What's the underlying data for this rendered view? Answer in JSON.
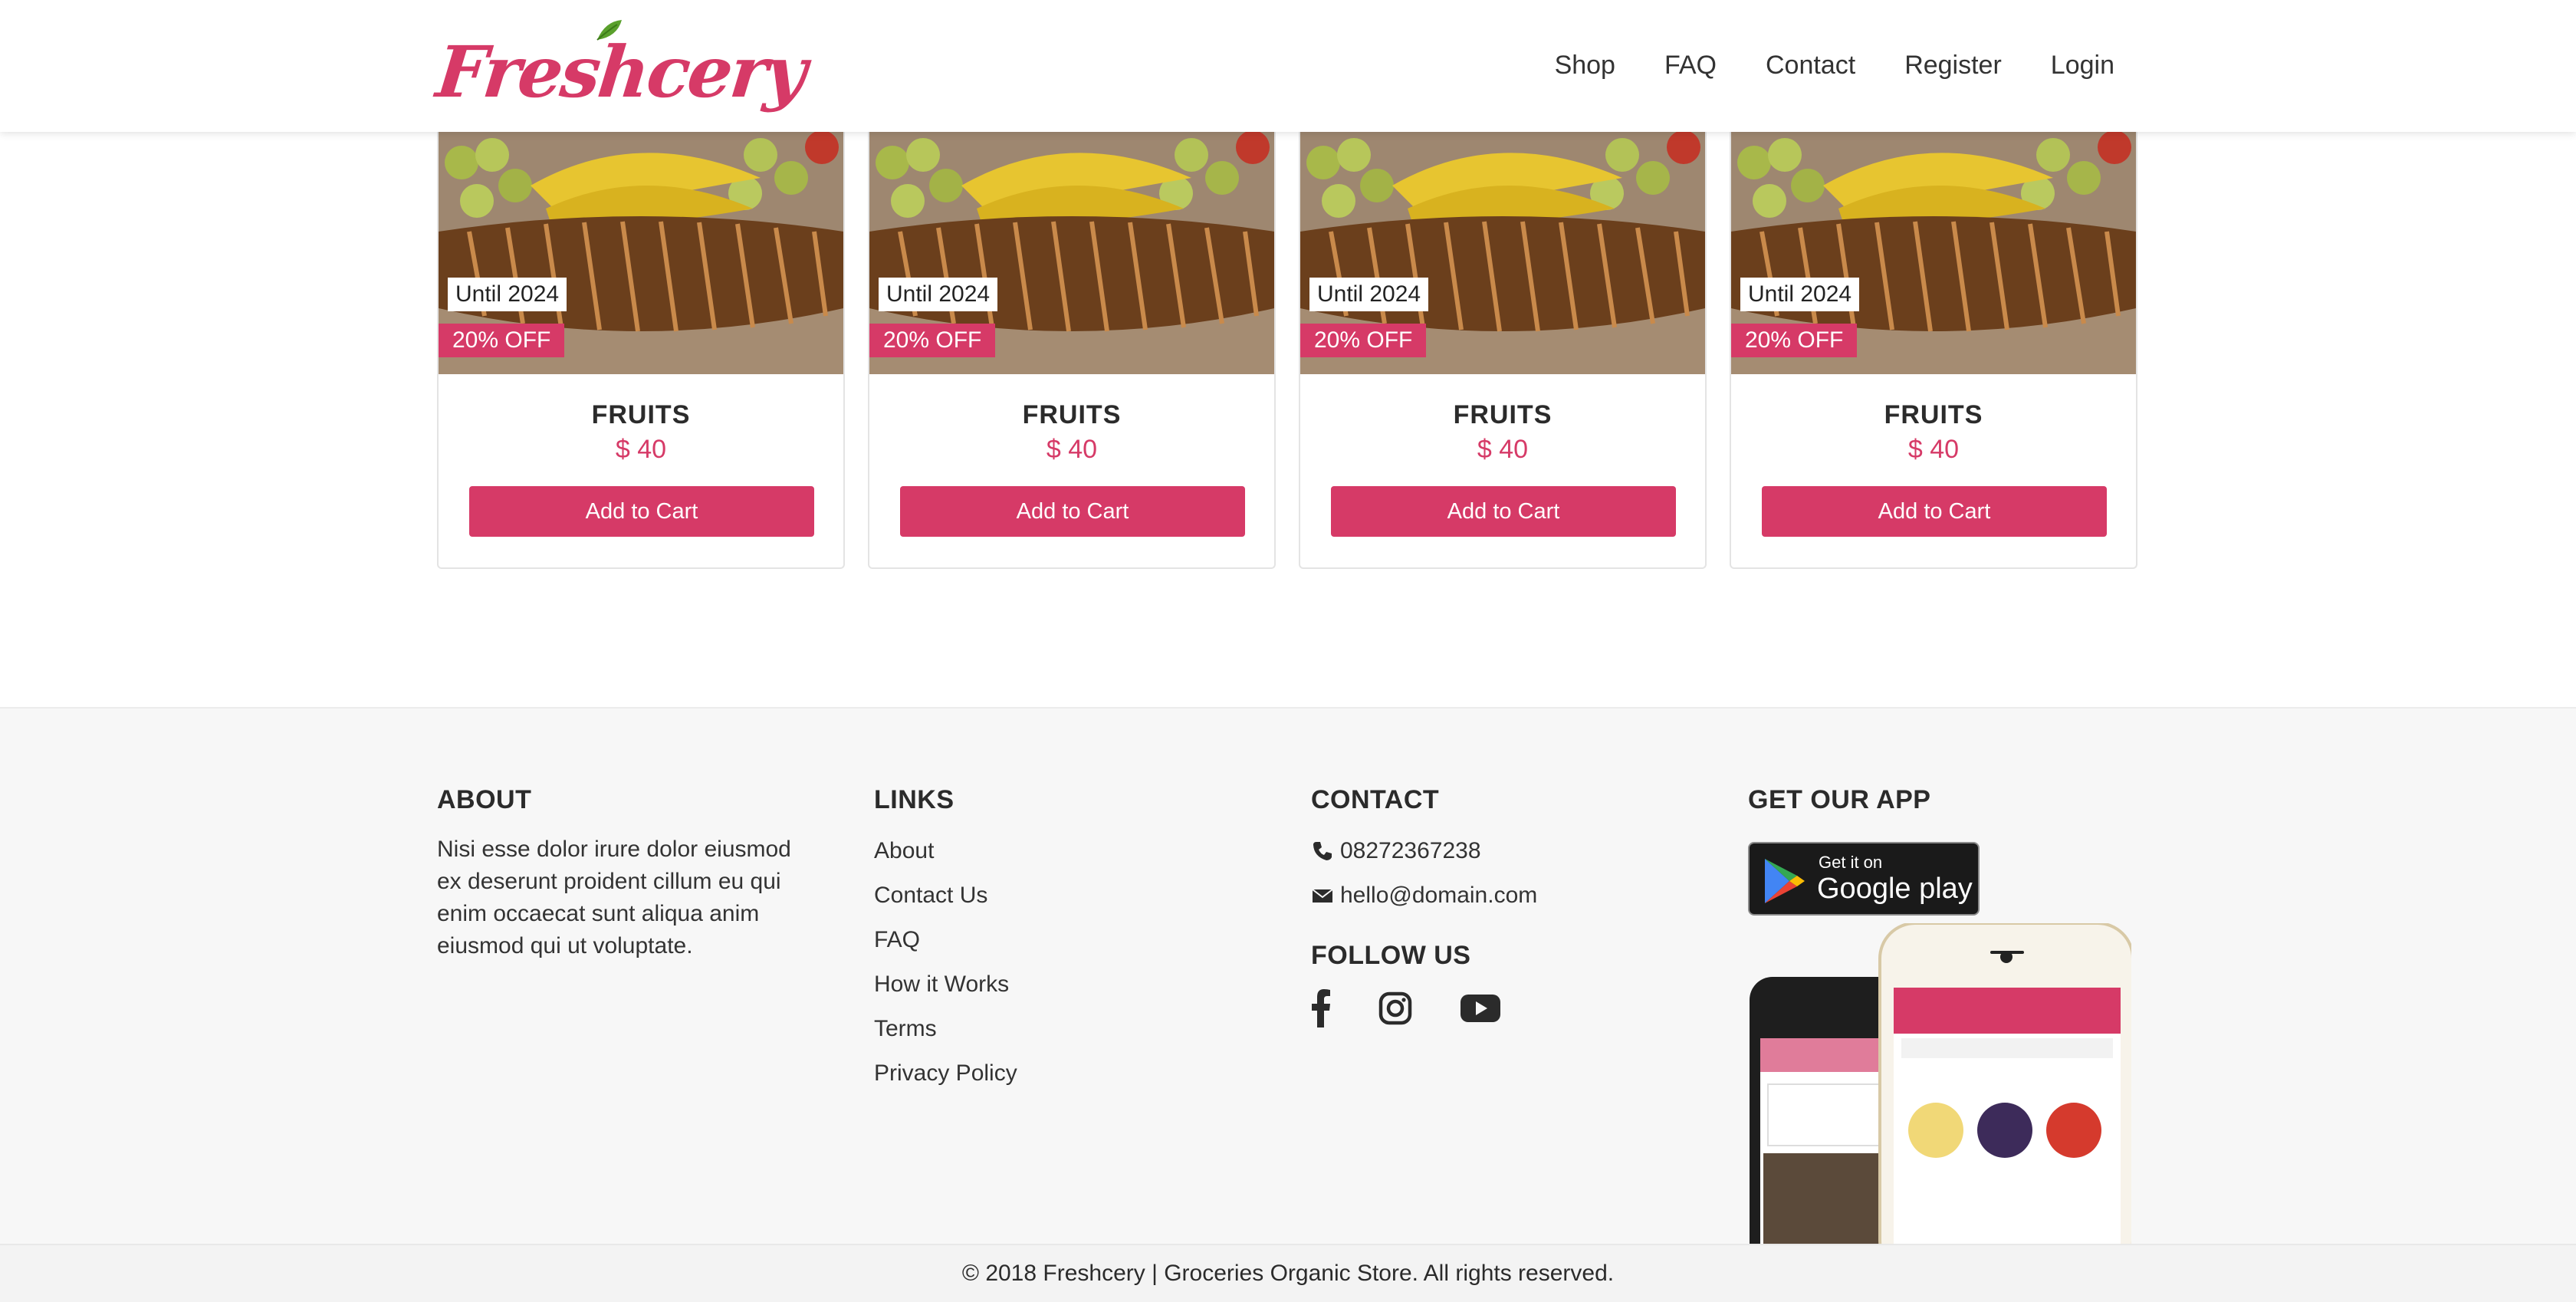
{
  "brand": {
    "name": "Freshcery",
    "color": "#d63a67"
  },
  "nav": {
    "items": [
      {
        "label": "Shop"
      },
      {
        "label": "FAQ"
      },
      {
        "label": "Contact"
      },
      {
        "label": "Register"
      },
      {
        "label": "Login"
      }
    ]
  },
  "products": [
    {
      "until": "Until 2024",
      "discount": "20% OFF",
      "name": "FRUITS",
      "price": "$ 40",
      "button": "Add to Cart"
    },
    {
      "until": "Until 2024",
      "discount": "20% OFF",
      "name": "FRUITS",
      "price": "$ 40",
      "button": "Add to Cart"
    },
    {
      "until": "Until 2024",
      "discount": "20% OFF",
      "name": "FRUITS",
      "price": "$ 40",
      "button": "Add to Cart"
    },
    {
      "until": "Until 2024",
      "discount": "20% OFF",
      "name": "FRUITS",
      "price": "$ 40",
      "button": "Add to Cart"
    }
  ],
  "footer": {
    "about": {
      "title": "ABOUT",
      "text": "Nisi esse dolor irure dolor eiusmod ex deserunt proident cillum eu qui enim occaecat sunt aliqua anim eiusmod qui ut voluptate."
    },
    "links": {
      "title": "LINKS",
      "items": [
        "About",
        "Contact Us",
        "FAQ",
        "How it Works",
        "Terms",
        "Privacy Policy"
      ]
    },
    "contact": {
      "title": "CONTACT",
      "phone": "08272367238",
      "email": "hello@domain.com",
      "follow_title": "FOLLOW US",
      "social_icons": [
        "facebook-icon",
        "instagram-icon",
        "youtube-icon"
      ]
    },
    "app": {
      "title": "GET OUR APP",
      "store_small": "Get it on",
      "store_big": "Google play"
    }
  },
  "copyright": "© 2018 Freshcery | Groceries Organic Store. All rights reserved."
}
